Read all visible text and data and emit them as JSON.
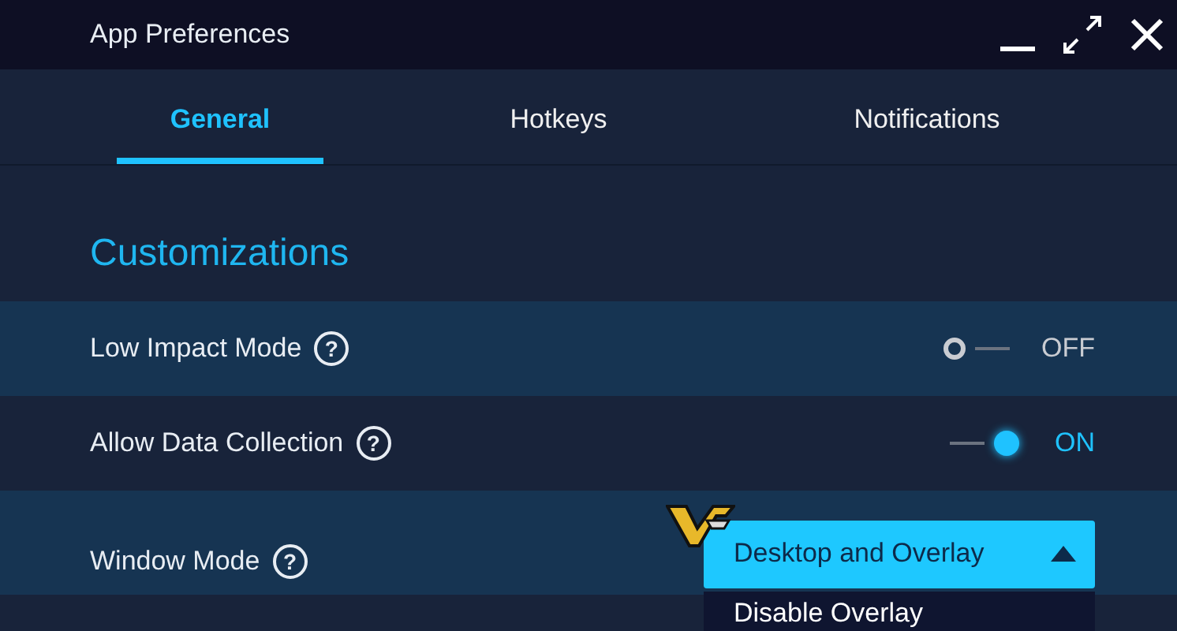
{
  "window": {
    "title": "App Preferences"
  },
  "tabs": [
    {
      "label": "General",
      "selected": true
    },
    {
      "label": "Hotkeys",
      "selected": false
    },
    {
      "label": "Notifications",
      "selected": false
    }
  ],
  "section": {
    "title": "Customizations"
  },
  "settings": [
    {
      "kind": "toggle",
      "label": "Low Impact Mode",
      "help": "?",
      "on": false,
      "state_text": "OFF"
    },
    {
      "kind": "toggle",
      "label": "Allow Data Collection",
      "help": "?",
      "on": true,
      "state_text": "ON"
    },
    {
      "kind": "dropdown",
      "label": "Window Mode",
      "help": "?",
      "value": "Desktop and Overlay",
      "expanded": true,
      "options": [
        "Disable Overlay"
      ]
    }
  ]
}
